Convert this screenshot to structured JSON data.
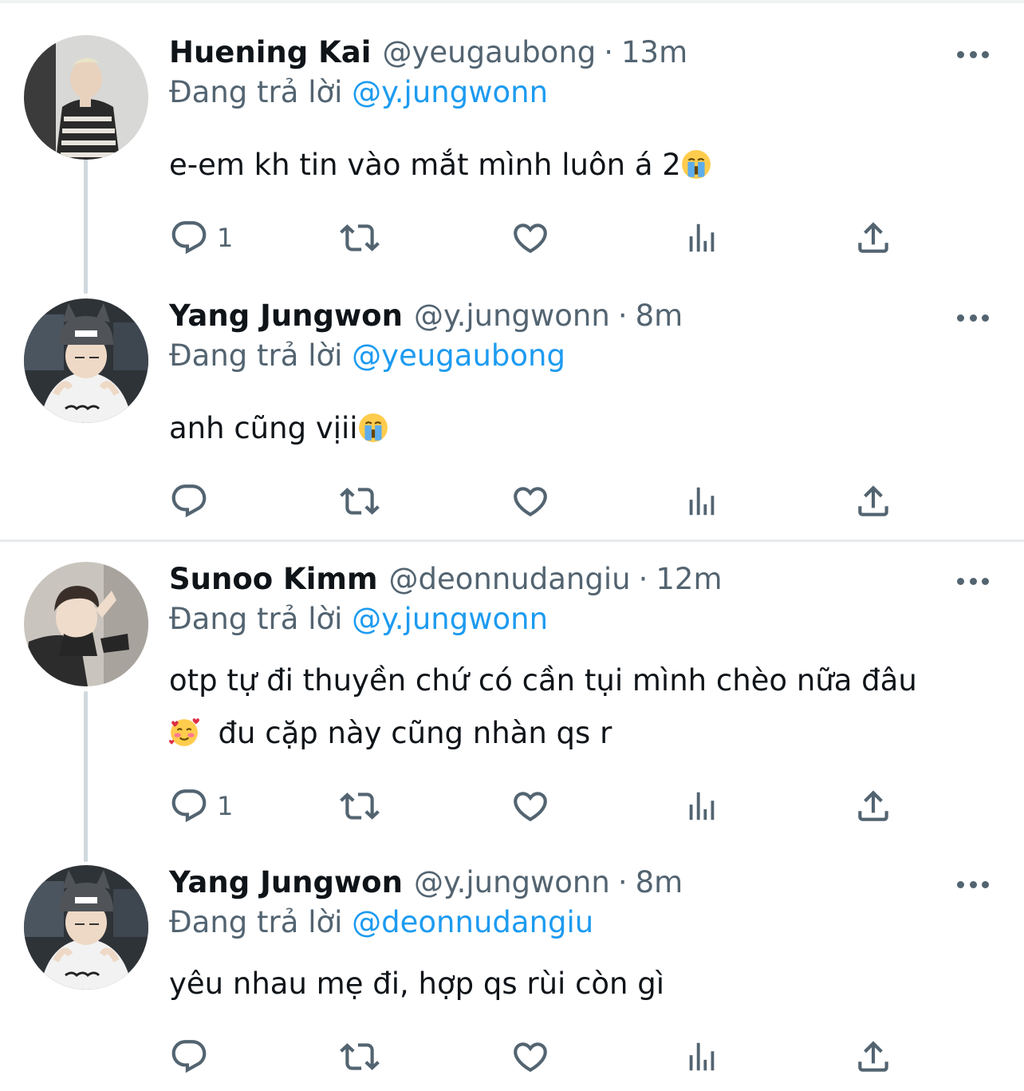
{
  "colors": {
    "accent": "#1d9bf0",
    "secondary_text": "#536471",
    "primary_text": "#0f1419",
    "thread_line": "#cfd9de"
  },
  "tweets": [
    {
      "name": "Huening Kai",
      "handle": "@yeugaubong",
      "separator": "·",
      "time": "13m",
      "reply_prefix": "Đang trả lời",
      "reply_to": "@y.jungwonn",
      "lines": [
        "e-em kh tin vào mắt mình luôn á 2"
      ],
      "emoji_after_line": "crying-face",
      "reply_count": "1"
    },
    {
      "name": "Yang Jungwon",
      "handle": "@y.jungwonn",
      "separator": "·",
      "time": "8m",
      "reply_prefix": "Đang trả lời",
      "reply_to": "@yeugaubong",
      "lines": [
        "anh cũng vịii"
      ],
      "emoji_after_line": "crying-face",
      "reply_count": ""
    },
    {
      "name": "Sunoo Kimm",
      "handle": "@deonnudangiu",
      "separator": "·",
      "time": "12m",
      "reply_prefix": "Đang trả lời",
      "reply_to": "@y.jungwonn",
      "lines": [
        "otp tự đi thuyền chứ có cần tụi mình chèo nữa đâu",
        "đu cặp này cũng nhàn qs r"
      ],
      "emoji_before_line2": "smiling-face-with-hearts",
      "reply_count": "1"
    },
    {
      "name": "Yang Jungwon",
      "handle": "@y.jungwonn",
      "separator": "·",
      "time": "8m",
      "reply_prefix": "Đang trả lời",
      "reply_to": "@deonnudangiu",
      "lines": [
        "yêu nhau mẹ đi, hợp qs rùi còn gì"
      ],
      "reply_count": ""
    }
  ],
  "action_icons": [
    "reply-icon",
    "retweet-icon",
    "like-icon",
    "analytics-icon",
    "share-icon"
  ]
}
